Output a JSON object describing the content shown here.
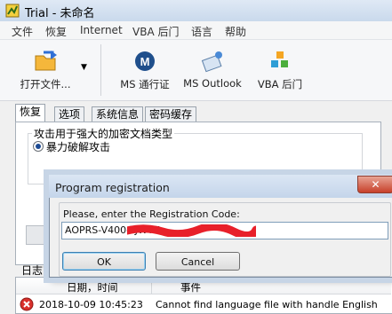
{
  "window": {
    "title": "Trial - 未命名"
  },
  "menu": [
    "文件",
    "恢复",
    "Internet",
    "VBA 后门",
    "语言",
    "帮助"
  ],
  "toolbar": {
    "open_label": "打开文件...",
    "ms_passport_label": "MS 通行证",
    "ms_outlook_label": "MS Outlook",
    "vba_backdoor_label": "VBA 后门"
  },
  "tabs": [
    "恢复",
    "选项",
    "系统信息",
    "密码缓存"
  ],
  "recovery": {
    "group_title": "攻击用于强大的加密文档类型",
    "option_label": "暴力破解攻击"
  },
  "log": {
    "label": "日志窗",
    "col_datetime": "日期，时间",
    "col_event": "事件",
    "rows": [
      {
        "datetime": "2018-10-09 10:45:23",
        "event": "Cannot find language file with handle English"
      }
    ]
  },
  "dialog": {
    "title": "Program registration",
    "prompt": "Please, enter the Registration Code:",
    "code_value": "AOPRS-V400-TJWTY",
    "ok_label": "OK",
    "cancel_label": "Cancel",
    "close_glyph": "✕"
  },
  "colors": {
    "accent": "#3c7fb1",
    "redaction": "#e8202a"
  }
}
